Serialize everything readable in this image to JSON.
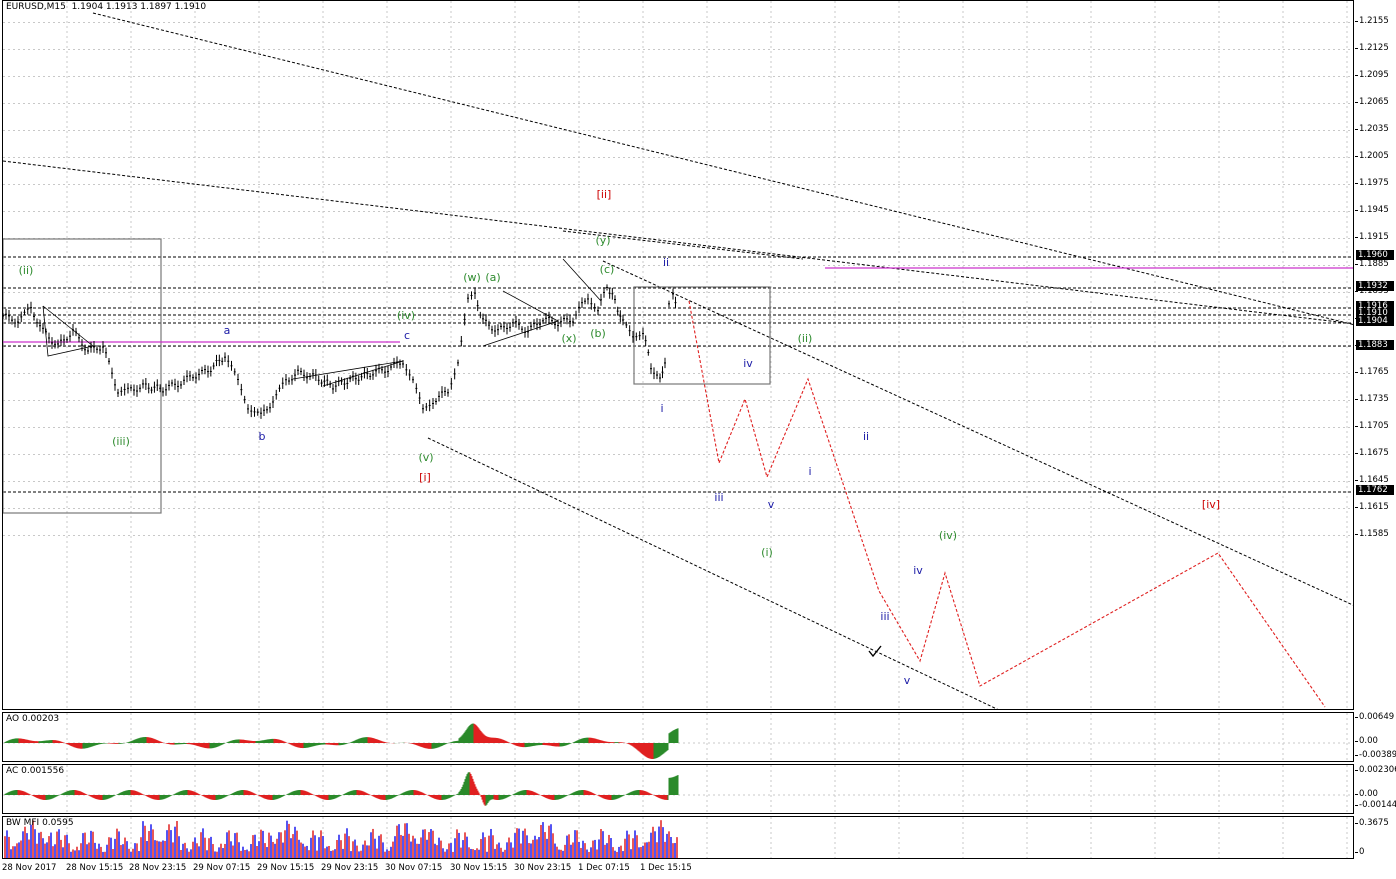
{
  "main_chart": {
    "title": "EURUSD,M15",
    "ohlc": "1.1904 1.1913 1.1897 1.1910",
    "price_ticks": [
      "1.2155",
      "1.2125",
      "1.2095",
      "1.2065",
      "1.2035",
      "1.2005",
      "1.1975",
      "1.1945",
      "1.1915",
      "1.1885",
      "1.1855",
      "1.1825",
      "1.1795",
      "1.1765",
      "1.1735",
      "1.1705",
      "1.1675",
      "1.1645",
      "1.1615",
      "1.1585"
    ],
    "price_boxes": [
      "1.1960",
      "1.1932",
      "1.1916",
      "1.1910",
      "1.1904",
      "1.1883",
      "1.1762"
    ],
    "wave_labels": [
      {
        "text": "(ii)",
        "color": "#2e8b2e"
      },
      {
        "text": "(iii)",
        "color": "#2e8b2e"
      },
      {
        "text": "a",
        "color": "#1a1aa6"
      },
      {
        "text": "b",
        "color": "#1a1aa6"
      },
      {
        "text": "c",
        "color": "#1a1aa6"
      },
      {
        "text": "(iv)",
        "color": "#2e8b2e"
      },
      {
        "text": "(v)",
        "color": "#2e8b2e"
      },
      {
        "text": "[i]",
        "color": "#cc0000"
      },
      {
        "text": "(w)",
        "color": "#2e8b2e"
      },
      {
        "text": "(a)",
        "color": "#2e8b2e"
      },
      {
        "text": "(x)",
        "color": "#2e8b2e"
      },
      {
        "text": "(b)",
        "color": "#2e8b2e"
      },
      {
        "text": "(c)",
        "color": "#2e8b2e"
      },
      {
        "text": "(y)",
        "color": "#2e8b2e"
      },
      {
        "text": "[ii]",
        "color": "#cc0000"
      },
      {
        "text": "ii",
        "color": "#1a1aa6"
      },
      {
        "text": "i",
        "color": "#1a1aa6"
      },
      {
        "text": "iv",
        "color": "#1a1aa6"
      },
      {
        "text": "iii",
        "color": "#1a1aa6"
      },
      {
        "text": "v",
        "color": "#1a1aa6"
      },
      {
        "text": "(i)",
        "color": "#2e8b2e"
      },
      {
        "text": "(ii)",
        "color": "#2e8b2e"
      },
      {
        "text": "i",
        "color": "#1a1aa6"
      },
      {
        "text": "ii",
        "color": "#1a1aa6"
      },
      {
        "text": "iii",
        "color": "#1a1aa6"
      },
      {
        "text": "iv",
        "color": "#1a1aa6"
      },
      {
        "text": "v",
        "color": "#1a1aa6"
      },
      {
        "text": "(iv)",
        "color": "#2e8b2e"
      },
      {
        "text": "[iv]",
        "color": "#cc0000"
      }
    ]
  },
  "ao": {
    "title": "AO 0.00203",
    "ticks": [
      "0.00649",
      "0.00",
      "-0.00389"
    ]
  },
  "ac": {
    "title": "AC 0.001556",
    "ticks": [
      "0.002306",
      "0.00",
      "-0.00144"
    ]
  },
  "mfi": {
    "title": "BW MFI 0.0595",
    "ticks": [
      "0.3675",
      "0"
    ]
  },
  "time_labels": [
    "28 Nov 2017",
    "28 Nov 15:15",
    "28 Nov 23:15",
    "29 Nov 07:15",
    "29 Nov 15:15",
    "29 Nov 23:15",
    "30 Nov 07:15",
    "30 Nov 15:15",
    "30 Nov 23:15",
    "1 Dec 07:15",
    "1 Dec 15:15"
  ],
  "colors": {
    "up": "#2a8a2a",
    "down": "#e02020",
    "forecast": "#e02020",
    "magenta": "#cc33cc",
    "wave_green": "#2e8b2e",
    "wave_blue": "#1a1aa6",
    "wave_red": "#cc0000"
  }
}
